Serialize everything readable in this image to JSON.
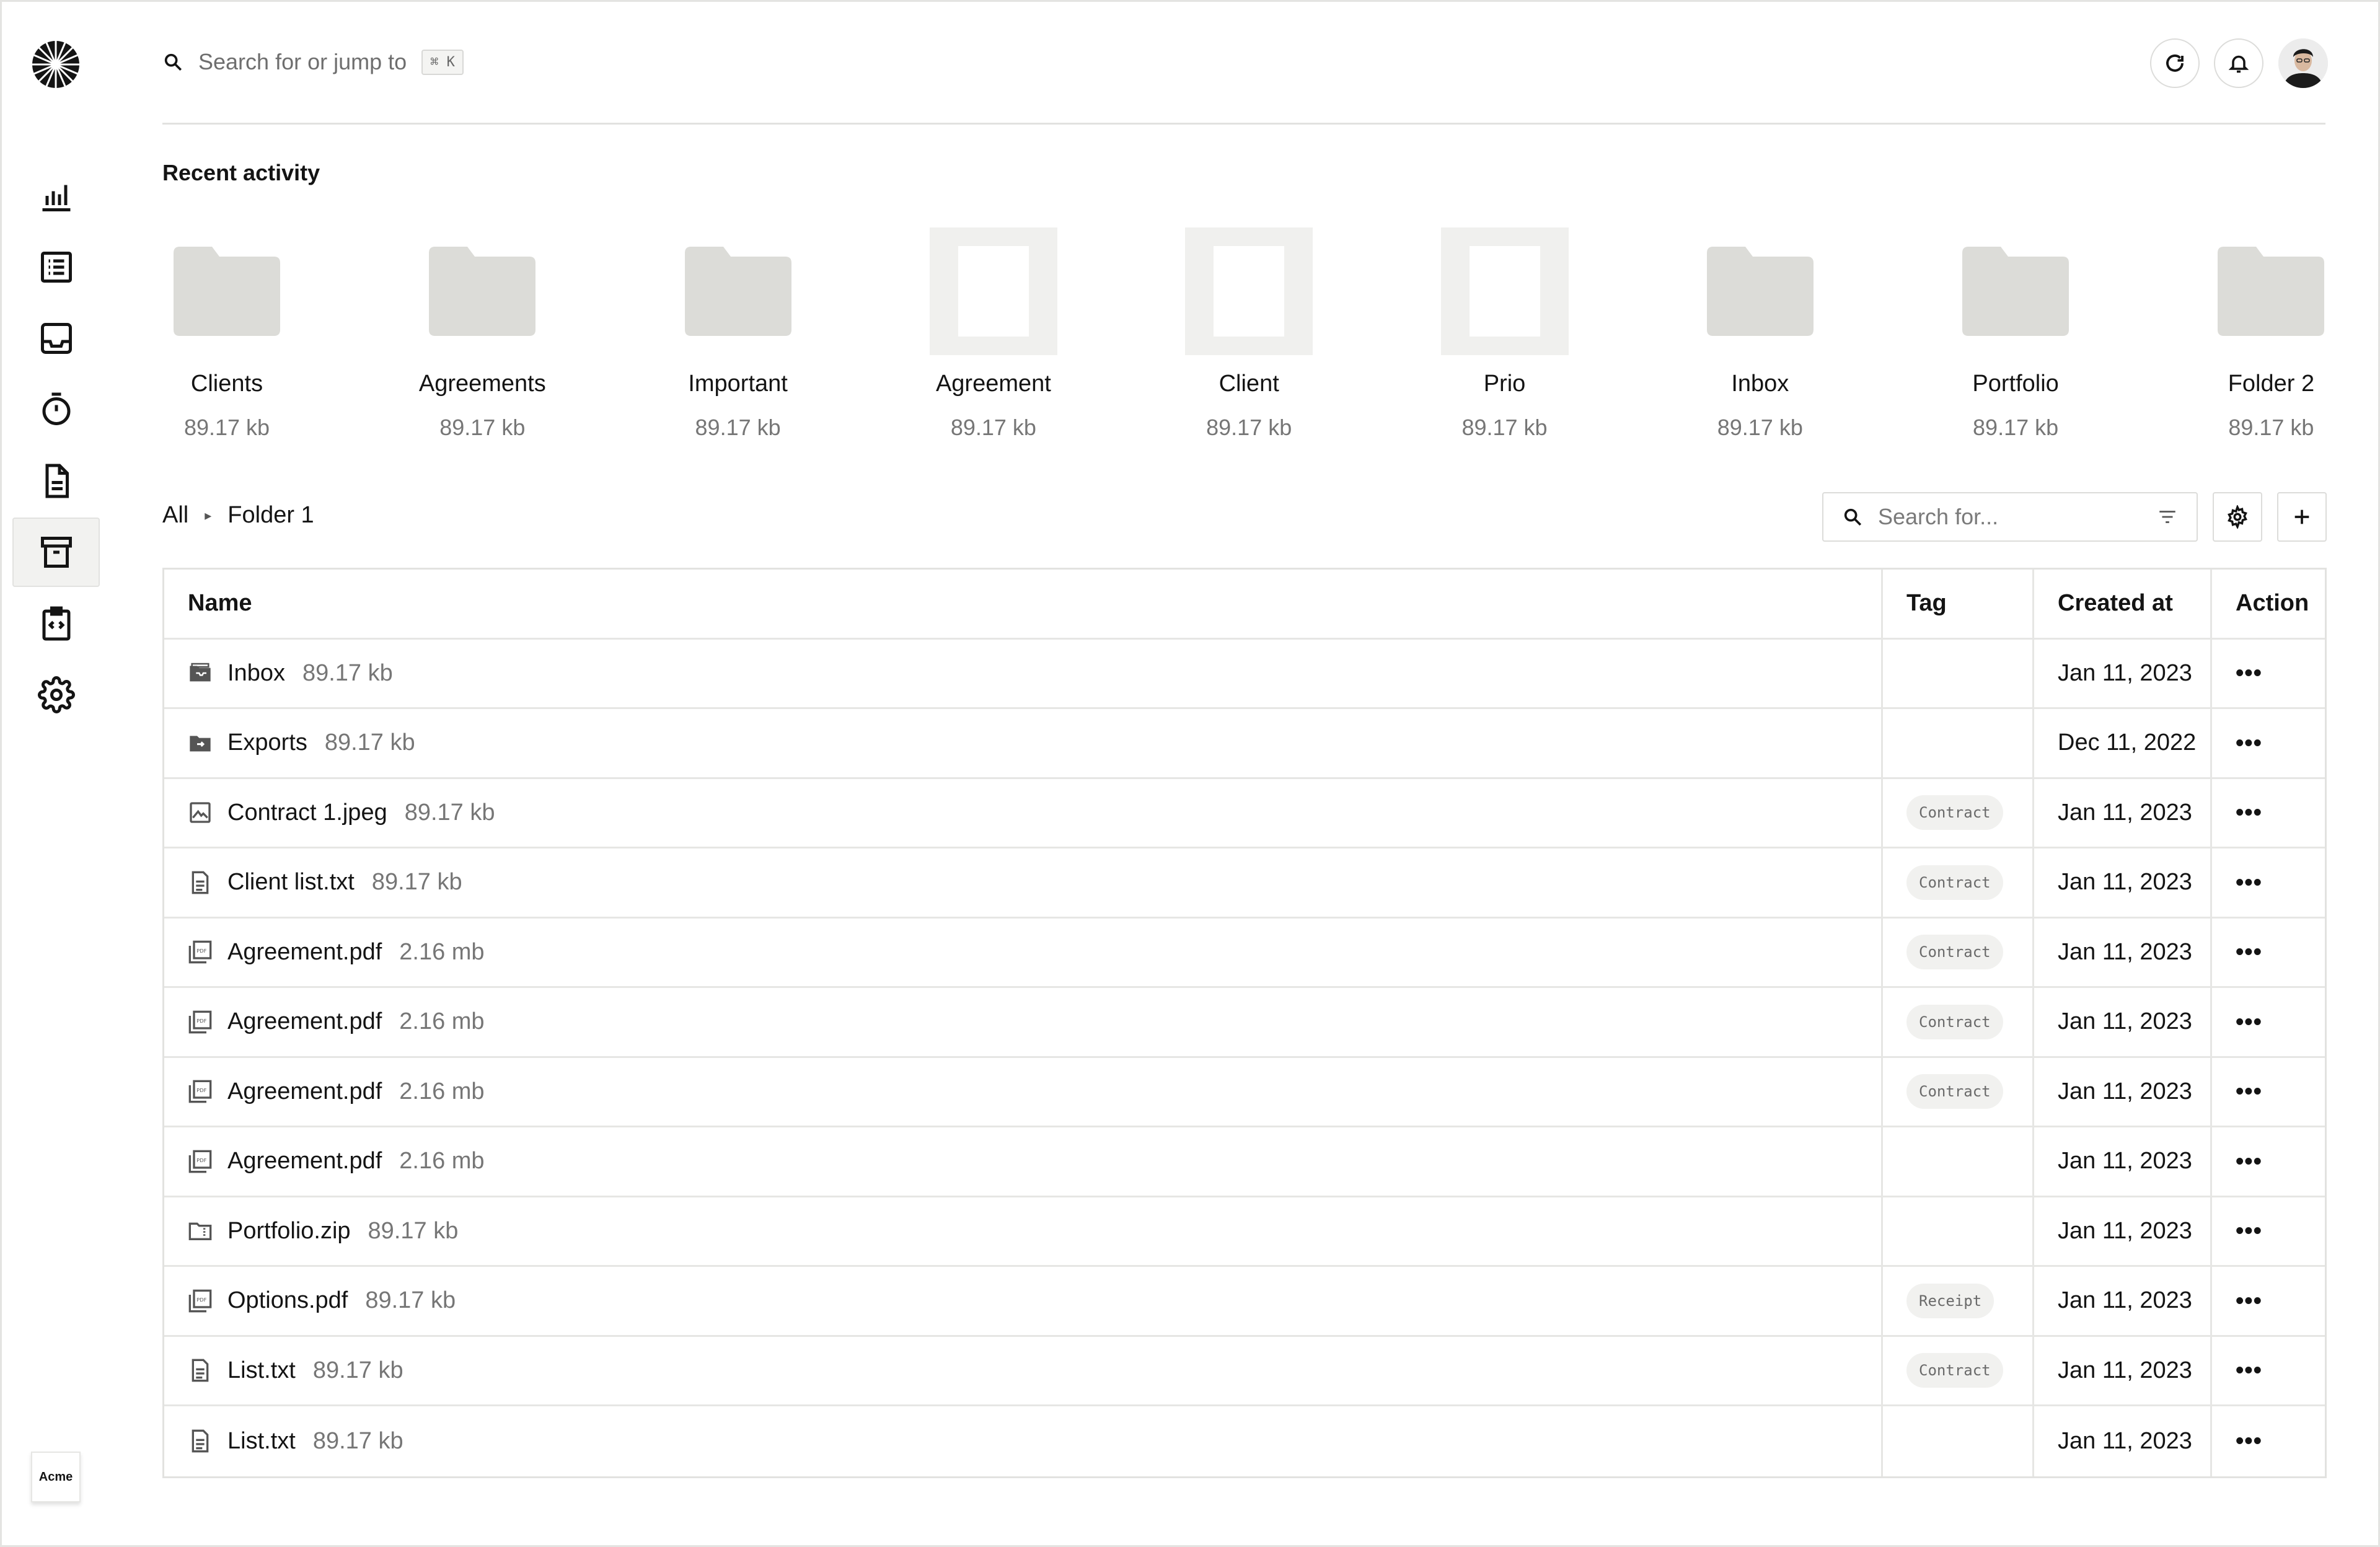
{
  "search": {
    "placeholder": "Search for or jump to",
    "shortcut": "⌘ K"
  },
  "brand": {
    "name": "Acme"
  },
  "sidebar": {
    "items": [
      {
        "name": "analytics",
        "icon": "bar-chart-icon"
      },
      {
        "name": "list",
        "icon": "list-icon"
      },
      {
        "name": "inbox",
        "icon": "inbox-icon"
      },
      {
        "name": "timer",
        "icon": "timer-icon"
      },
      {
        "name": "documents",
        "icon": "document-icon"
      },
      {
        "name": "archive",
        "icon": "archive-icon",
        "active": true
      },
      {
        "name": "code",
        "icon": "code-clipboard-icon"
      },
      {
        "name": "settings",
        "icon": "gear-icon"
      }
    ]
  },
  "recent": {
    "title": "Recent activity",
    "items": [
      {
        "name": "Clients",
        "size": "89.17 kb",
        "kind": "folder"
      },
      {
        "name": "Agreements",
        "size": "89.17 kb",
        "kind": "folder"
      },
      {
        "name": "Important",
        "size": "89.17 kb",
        "kind": "folder"
      },
      {
        "name": "Agreement",
        "size": "89.17 kb",
        "kind": "document"
      },
      {
        "name": "Client",
        "size": "89.17 kb",
        "kind": "document"
      },
      {
        "name": "Prio",
        "size": "89.17 kb",
        "kind": "document"
      },
      {
        "name": "Inbox",
        "size": "89.17 kb",
        "kind": "folder"
      },
      {
        "name": "Portfolio",
        "size": "89.17 kb",
        "kind": "folder"
      },
      {
        "name": "Folder 2",
        "size": "89.17 kb",
        "kind": "folder"
      }
    ]
  },
  "breadcrumb": {
    "root": "All",
    "current": "Folder 1"
  },
  "files": {
    "search_placeholder": "Search for...",
    "columns": {
      "name": "Name",
      "tag": "Tag",
      "created": "Created at",
      "action": "Action"
    },
    "action_label": "•••",
    "rows": [
      {
        "icon": "folder-inbox-icon",
        "name": "Inbox",
        "size": "89.17 kb",
        "tag": "",
        "created": "Jan 11, 2023"
      },
      {
        "icon": "folder-export-icon",
        "name": "Exports",
        "size": "89.17 kb",
        "tag": "",
        "created": "Dec 11, 2022"
      },
      {
        "icon": "image-file-icon",
        "name": "Contract 1.jpeg",
        "size": "89.17 kb",
        "tag": "Contract",
        "created": "Jan 11, 2023"
      },
      {
        "icon": "text-file-icon",
        "name": "Client list.txt",
        "size": "89.17 kb",
        "tag": "Contract",
        "created": "Jan 11, 2023"
      },
      {
        "icon": "pdf-file-icon",
        "name": "Agreement.pdf",
        "size": "2.16 mb",
        "tag": "Contract",
        "created": "Jan 11, 2023"
      },
      {
        "icon": "pdf-file-icon",
        "name": "Agreement.pdf",
        "size": "2.16 mb",
        "tag": "Contract",
        "created": "Jan 11, 2023"
      },
      {
        "icon": "pdf-file-icon",
        "name": "Agreement.pdf",
        "size": "2.16 mb",
        "tag": "Contract",
        "created": "Jan 11, 2023"
      },
      {
        "icon": "pdf-file-icon",
        "name": "Agreement.pdf",
        "size": "2.16 mb",
        "tag": "",
        "created": "Jan 11, 2023"
      },
      {
        "icon": "zip-folder-icon",
        "name": "Portfolio.zip",
        "size": "89.17 kb",
        "tag": "",
        "created": "Jan 11, 2023"
      },
      {
        "icon": "pdf-file-icon",
        "name": "Options.pdf",
        "size": "89.17 kb",
        "tag": "Receipt",
        "created": "Jan 11, 2023"
      },
      {
        "icon": "text-file-icon",
        "name": "List.txt",
        "size": "89.17 kb",
        "tag": "Contract",
        "created": "Jan 11, 2023"
      },
      {
        "icon": "text-file-icon",
        "name": "List.txt",
        "size": "89.17 kb",
        "tag": "",
        "created": "Jan 11, 2023"
      }
    ]
  },
  "colors": {
    "tile_fill": "#dcdcd8",
    "border": "#e2e2e0",
    "tag_bg": "#f1f1ef",
    "muted_text": "#767676"
  }
}
